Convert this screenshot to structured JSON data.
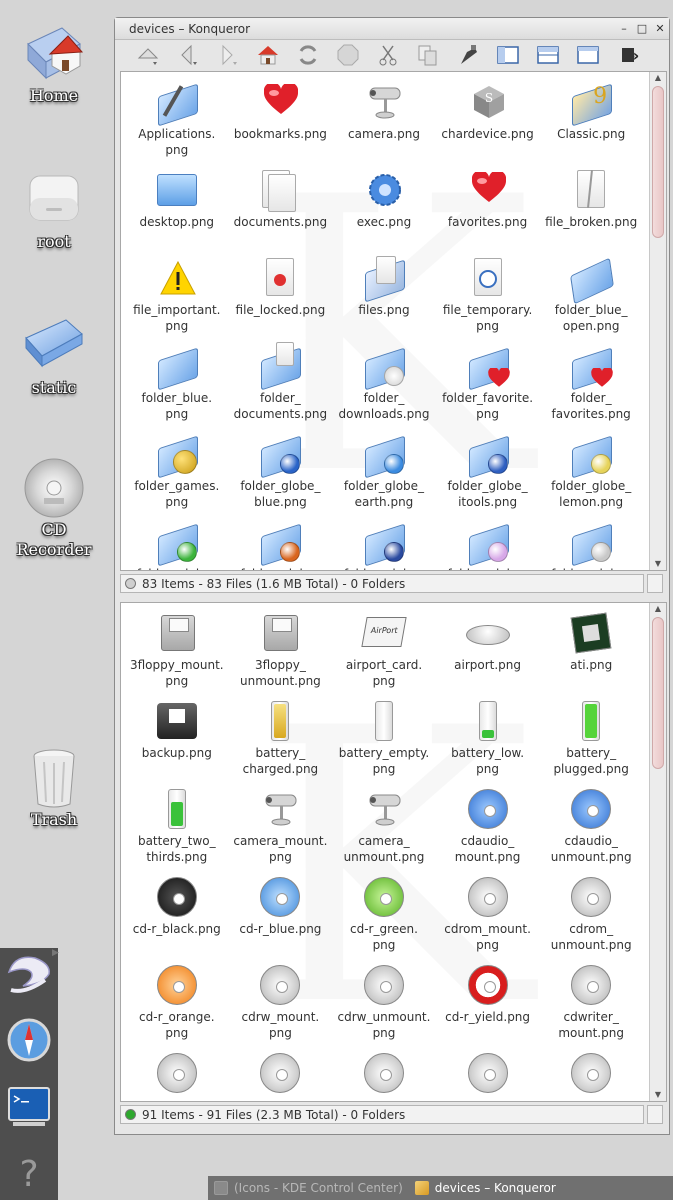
{
  "desktop": {
    "icons": [
      {
        "label": "Home",
        "icon": "home-icon"
      },
      {
        "label": "root",
        "icon": "drive-icon"
      },
      {
        "label": "static",
        "icon": "folder-icon"
      },
      {
        "label": "CD\nRecorder",
        "icon": "cd-icon"
      },
      {
        "label": "Trash",
        "icon": "trash-icon"
      }
    ]
  },
  "window": {
    "title": "devices – Konqueror",
    "toolbar_overflow": "»",
    "controls": {
      "minimize": "–",
      "maximize": "□",
      "close": "✕"
    }
  },
  "top_pane": {
    "items": [
      {
        "name": "Applications.\npng",
        "art": "apps"
      },
      {
        "name": "bookmarks.png",
        "art": "heart"
      },
      {
        "name": "camera.png",
        "art": "camera"
      },
      {
        "name": "chardevice.png",
        "art": "chardev"
      },
      {
        "name": "Classic.png",
        "art": "classic"
      },
      {
        "name": "desktop.png",
        "art": "desktop"
      },
      {
        "name": "documents.png",
        "art": "documents"
      },
      {
        "name": "exec.png",
        "art": "exec"
      },
      {
        "name": "favorites.png",
        "art": "heart"
      },
      {
        "name": "file_broken.png",
        "art": "broken"
      },
      {
        "name": "file_important.\npng",
        "art": "warning"
      },
      {
        "name": "file_locked.png",
        "art": "locked"
      },
      {
        "name": "files.png",
        "art": "files"
      },
      {
        "name": "file_temporary.\npng",
        "art": "temporary"
      },
      {
        "name": "folder_blue_\nopen.png",
        "art": "folder-open"
      },
      {
        "name": "folder_blue.\npng",
        "art": "folder"
      },
      {
        "name": "folder_\ndocuments.png",
        "art": "folder-docs"
      },
      {
        "name": "folder_\ndownloads.png",
        "art": "folder-down"
      },
      {
        "name": "folder_favorite.\npng",
        "art": "folder-heart"
      },
      {
        "name": "folder_\nfavorites.png",
        "art": "folder-heart"
      },
      {
        "name": "folder_games.\npng",
        "art": "folder-games"
      },
      {
        "name": "folder_globe_\nblue.png",
        "art": "folder-globe-blue"
      },
      {
        "name": "folder_globe_\nearth.png",
        "art": "folder-globe-earth"
      },
      {
        "name": "folder_globe_\nitools.png",
        "art": "folder-globe-itools"
      },
      {
        "name": "folder_globe_\nlemon.png",
        "art": "folder-globe-lemon"
      },
      {
        "name": "folder_globe_",
        "art": "folder-globe-green"
      },
      {
        "name": "folder_globe_",
        "art": "folder-globe-orange"
      },
      {
        "name": "folder_globe_",
        "art": "folder-globe-navy"
      },
      {
        "name": "folder_globe_",
        "art": "folder-globe-pink"
      },
      {
        "name": "folder_globe_",
        "art": "folder-globe-silver"
      }
    ],
    "status": "83 Items - 83 Files (1.6 MB Total) - 0 Folders",
    "status_led": "#cfcfcf"
  },
  "bottom_pane": {
    "items": [
      {
        "name": "3floppy_mount.\npng",
        "art": "floppy"
      },
      {
        "name": "3floppy_\nunmount.png",
        "art": "floppy"
      },
      {
        "name": "airport_card.\npng",
        "art": "airport-card"
      },
      {
        "name": "airport.png",
        "art": "airport"
      },
      {
        "name": "ati.png",
        "art": "ati"
      },
      {
        "name": "backup.png",
        "art": "backup"
      },
      {
        "name": "battery_\ncharged.png",
        "art": "battery-charged"
      },
      {
        "name": "battery_empty.\npng",
        "art": "battery-empty"
      },
      {
        "name": "battery_low.\npng",
        "art": "battery-low"
      },
      {
        "name": "battery_\nplugged.png",
        "art": "battery-plugged"
      },
      {
        "name": "battery_two_\nthirds.png",
        "art": "battery-two"
      },
      {
        "name": "camera_mount.\npng",
        "art": "camera"
      },
      {
        "name": "camera_\nunmount.png",
        "art": "camera"
      },
      {
        "name": "cdaudio_\nmount.png",
        "art": "disc-blue"
      },
      {
        "name": "cdaudio_\nunmount.png",
        "art": "disc-blue"
      },
      {
        "name": "cd-r_black.png",
        "art": "disc-black"
      },
      {
        "name": "cd-r_blue.png",
        "art": "disc-lightblue"
      },
      {
        "name": "cd-r_green.\npng",
        "art": "disc-green"
      },
      {
        "name": "cdrom_mount.\npng",
        "art": "disc-silver"
      },
      {
        "name": "cdrom_\nunmount.png",
        "art": "disc-silver"
      },
      {
        "name": "cd-r_orange.\npng",
        "art": "disc-orange"
      },
      {
        "name": "cdrw_mount.\npng",
        "art": "disc-silver"
      },
      {
        "name": "cdrw_unmount.\npng",
        "art": "disc-silver"
      },
      {
        "name": "cd-r_yield.png",
        "art": "disc-yield"
      },
      {
        "name": "cdwriter_\nmount.png",
        "art": "disc-silver"
      },
      {
        "name": "",
        "art": "disc-silver"
      },
      {
        "name": "",
        "art": "disc-dvd"
      },
      {
        "name": "",
        "art": "disc-dvd"
      },
      {
        "name": "",
        "art": "disc-dvd"
      },
      {
        "name": "",
        "art": "disc-dvd"
      }
    ],
    "status": "91 Items - 91 Files (2.3 MB Total) - 0 Folders",
    "status_led": "#2ea82e"
  },
  "taskbar": {
    "tasks": [
      {
        "label": "(Icons - KDE Control Center)",
        "active": false
      },
      {
        "label": "devices – Konqueror",
        "active": true
      }
    ]
  }
}
